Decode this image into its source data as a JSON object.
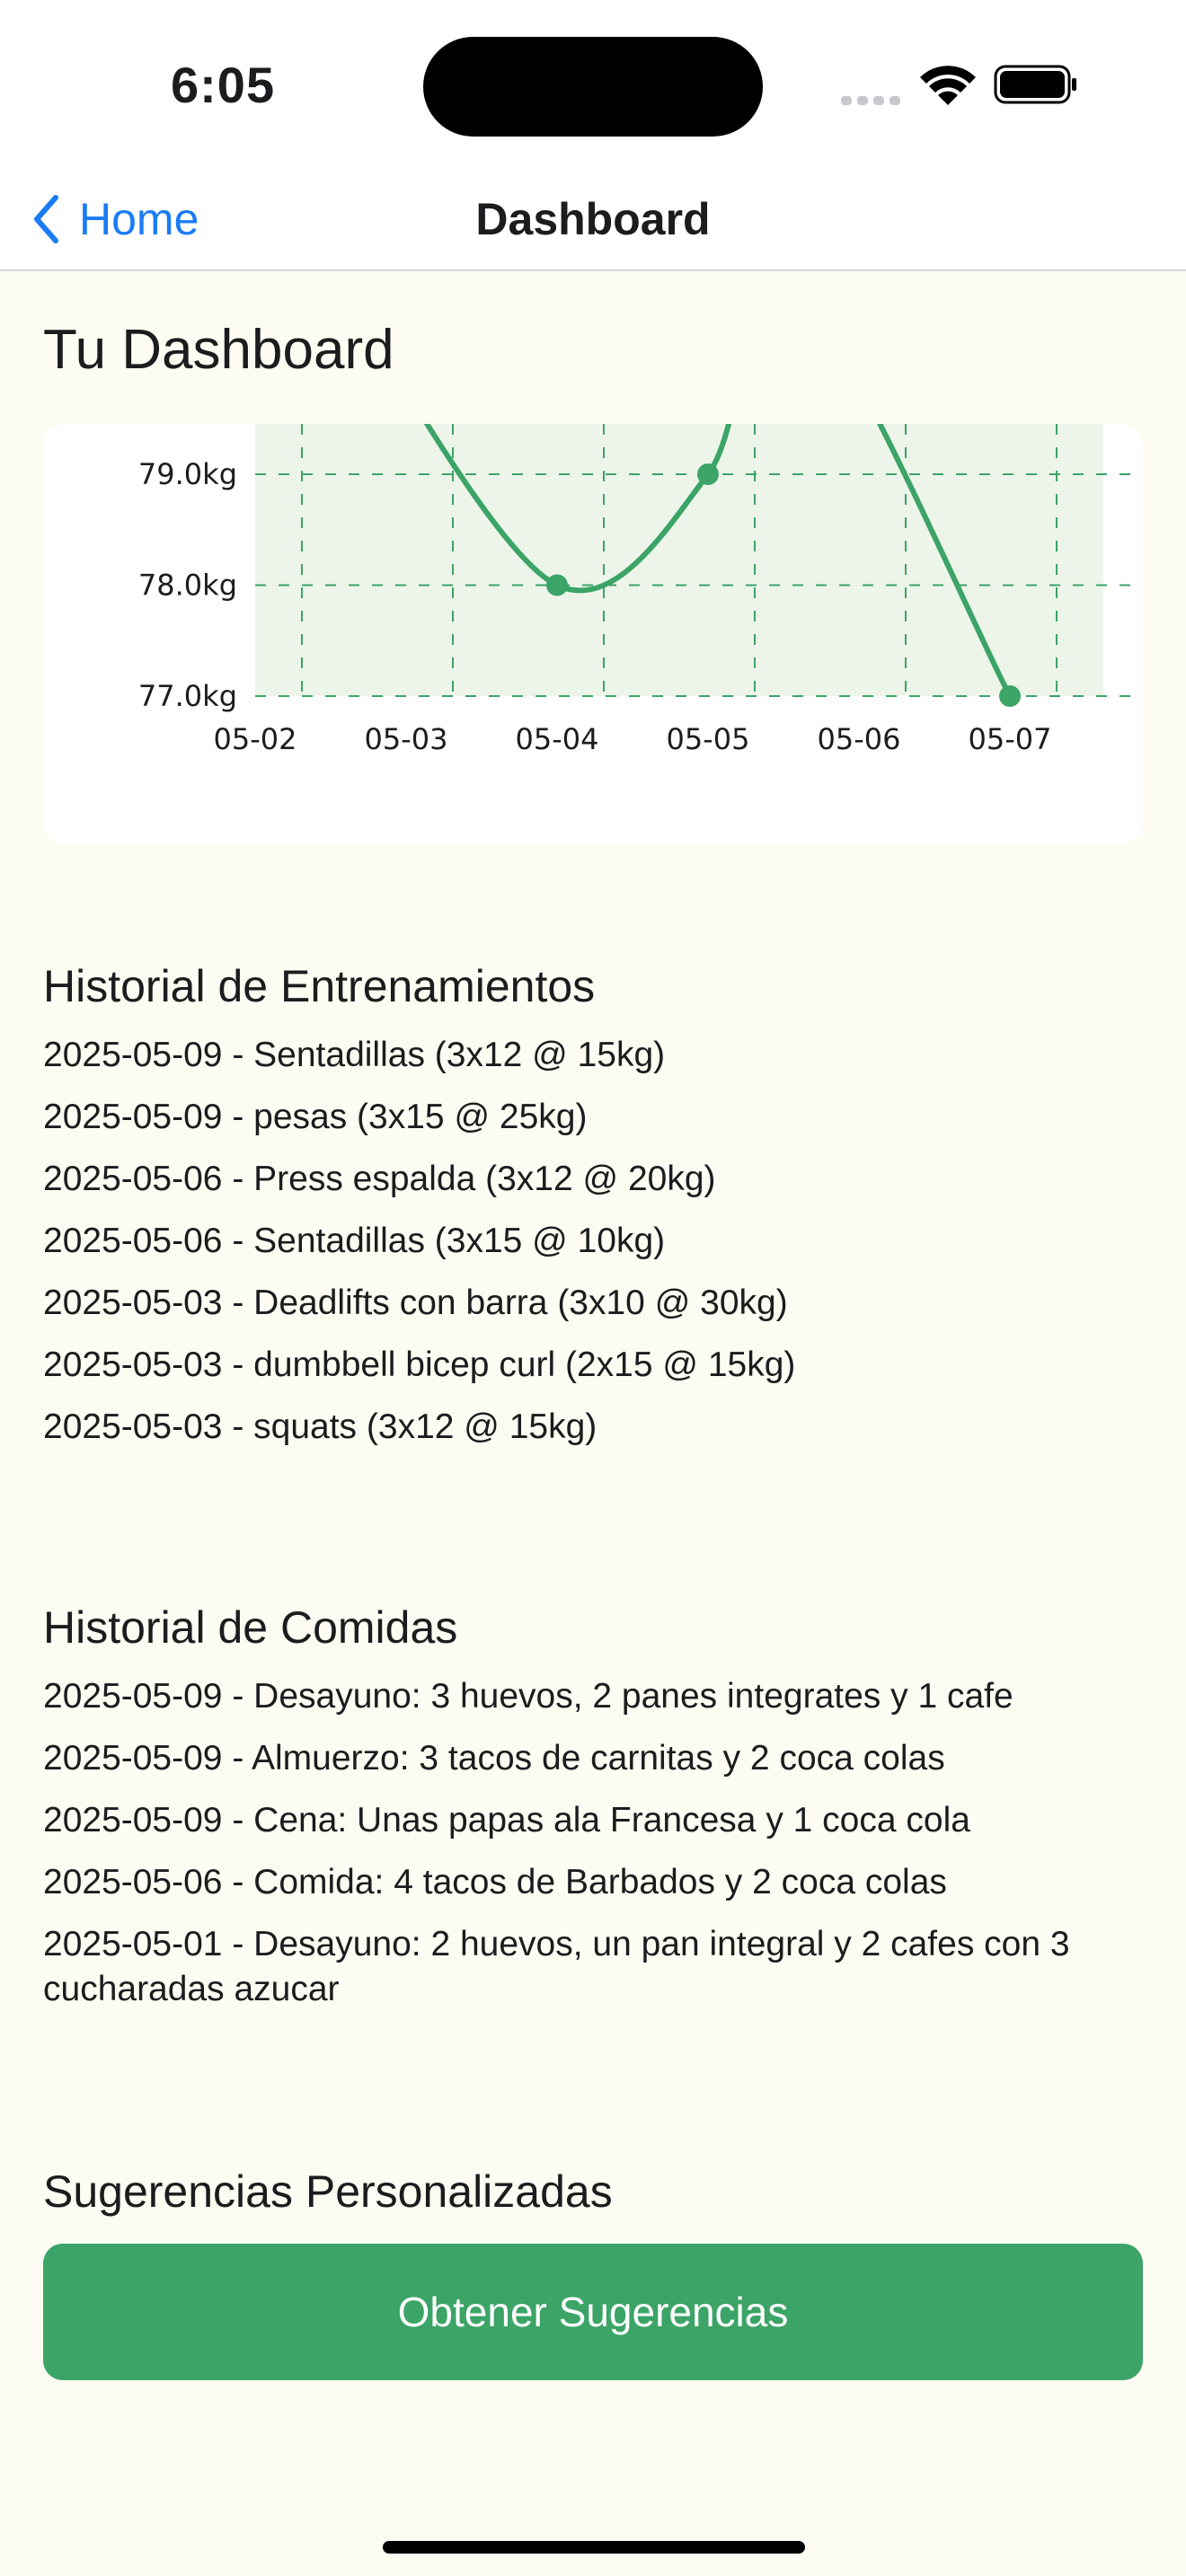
{
  "status_bar": {
    "time": "6:05"
  },
  "nav": {
    "back_label": "Home",
    "title": "Dashboard"
  },
  "dashboard": {
    "title": "Tu Dashboard"
  },
  "chart_data": {
    "type": "line",
    "x": [
      "05-02",
      "05-03",
      "05-04",
      "05-05",
      "05-06",
      "05-07"
    ],
    "y_ticks": [
      "79.0kg",
      "78.0kg",
      "77.0kg"
    ],
    "series": [
      {
        "x": [
          "05-04",
          "05-05",
          "05-07"
        ],
        "values": [
          78.0,
          79.0,
          77.0
        ]
      }
    ],
    "ylim": [
      77.0,
      79.0
    ],
    "grid": true,
    "line_color": "#3ba466",
    "fill_color": "#e8f4e6"
  },
  "workouts": {
    "title": "Historial de Entrenamientos",
    "items": [
      "2025-05-09 - Sentadillas (3x12 @ 15kg)",
      "2025-05-09 - pesas (3x15 @ 25kg)",
      "2025-05-06 - Press espalda (3x12 @ 20kg)",
      "2025-05-06 - Sentadillas (3x15 @ 10kg)",
      "2025-05-03 - Deadlifts con barra (3x10 @ 30kg)",
      "2025-05-03 - dumbbell bicep curl (2x15 @ 15kg)",
      "2025-05-03 - squats (3x12 @ 15kg)"
    ]
  },
  "meals": {
    "title": "Historial de Comidas",
    "items": [
      "2025-05-09 - Desayuno: 3 huevos, 2 panes integrates y 1 cafe",
      "2025-05-09 - Almuerzo: 3 tacos de carnitas y 2 coca colas",
      "2025-05-09 - Cena: Unas papas ala Francesa y 1 coca cola",
      "2025-05-06 - Comida: 4 tacos de Barbados y 2 coca colas",
      "2025-05-01 - Desayuno: 2 huevos, un pan integral y 2 cafes con 3 cucharadas azucar"
    ]
  },
  "suggestions": {
    "title": "Sugerencias Personalizadas",
    "button_label": "Obtener Sugerencias"
  },
  "colors": {
    "accent": "#3ba466",
    "link": "#1a7cf5",
    "background": "#FCFCF2"
  }
}
